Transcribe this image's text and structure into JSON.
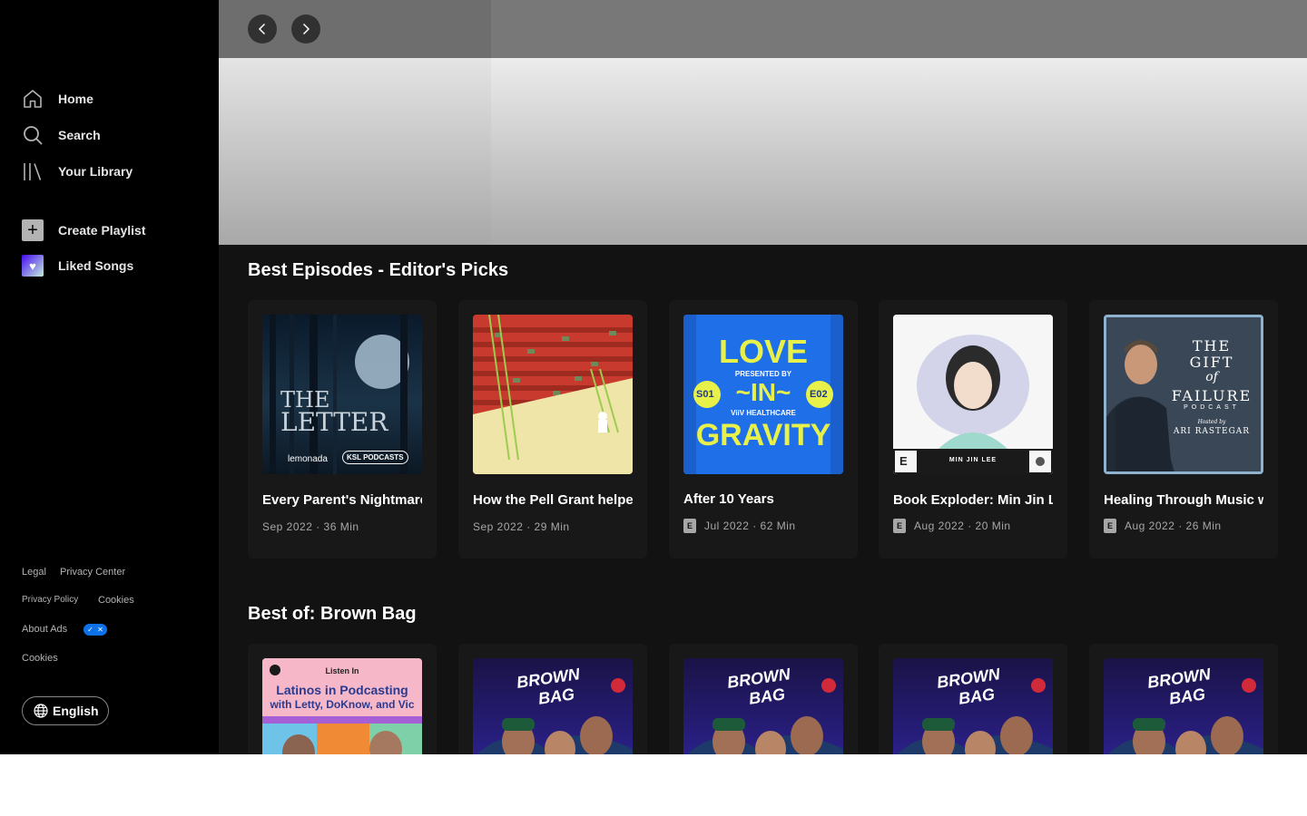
{
  "sidebar": {
    "nav": [
      {
        "label": "Home",
        "icon": "home-icon"
      },
      {
        "label": "Search",
        "icon": "search-icon"
      },
      {
        "label": "Your Library",
        "icon": "library-icon"
      }
    ],
    "actions": [
      {
        "label": "Create Playlist",
        "icon": "plus-icon"
      },
      {
        "label": "Liked Songs",
        "icon": "heart-icon"
      }
    ],
    "footer": {
      "legal": "Legal",
      "privacy_center": "Privacy Center",
      "privacy_policy": "Privacy Policy",
      "cookies_1": "Cookies",
      "about_ads": "About Ads",
      "cookies_2": "Cookies"
    },
    "language_label": "English"
  },
  "sections": [
    {
      "title": "Best Episodes - Editor's Picks",
      "cards": [
        {
          "title": "Every Parent's Nightmare",
          "meta": "Sep 2022 · 36 Min",
          "explicit": false,
          "art": {
            "line1": "THE",
            "line2": "LETTER",
            "brand1": "lemonada",
            "brand2": "KSL PODCASTS"
          }
        },
        {
          "title": "How the Pell Grant helped",
          "meta": "Sep 2022 · 29 Min",
          "explicit": false,
          "art": {}
        },
        {
          "title": "After 10 Years",
          "meta": "Jul 2022 · 62 Min",
          "explicit": true,
          "badge": "E",
          "art": {
            "line1": "LOVE",
            "line2": "PRESENTED BY",
            "line3": "~IN~",
            "line4": "ViiV HEALTHCARE",
            "line5": "GRAVITY",
            "season": "S01",
            "episode": "E02"
          }
        },
        {
          "title": "Book Exploder: Min Jin Lee",
          "meta": "Aug 2022 · 20 Min",
          "explicit": true,
          "badge": "E",
          "art": {
            "caption": "MIN JIN LEE",
            "corner": "E"
          }
        },
        {
          "title": "Healing Through Music with",
          "meta": "Aug 2022 · 26 Min",
          "explicit": true,
          "badge": "E",
          "art": {
            "line1": "THE",
            "line2": "GIFT",
            "line3": "of",
            "line4": "FAILURE",
            "line5": "PODCAST",
            "line6": "Hosted by",
            "line7": "ARI RASTEGAR"
          }
        }
      ]
    },
    {
      "title": "Best of: Brown Bag",
      "cards": [
        {
          "art": {
            "tag": "Listen In",
            "line1": "Latinos in Podcasting",
            "line2": "with Letty, DoKnow, and Vic"
          }
        },
        {
          "art": {
            "logo1": "BROWN",
            "logo2": "BAG"
          }
        },
        {
          "art": {
            "logo1": "BROWN",
            "logo2": "BAG"
          }
        },
        {
          "art": {
            "logo1": "BROWN",
            "logo2": "BAG"
          }
        },
        {
          "art": {
            "logo1": "BROWN",
            "logo2": "BAG"
          }
        }
      ]
    }
  ],
  "colors": {
    "background": "#121212",
    "sidebar": "#000000",
    "card": "#181818",
    "accent": "#1ed760"
  }
}
